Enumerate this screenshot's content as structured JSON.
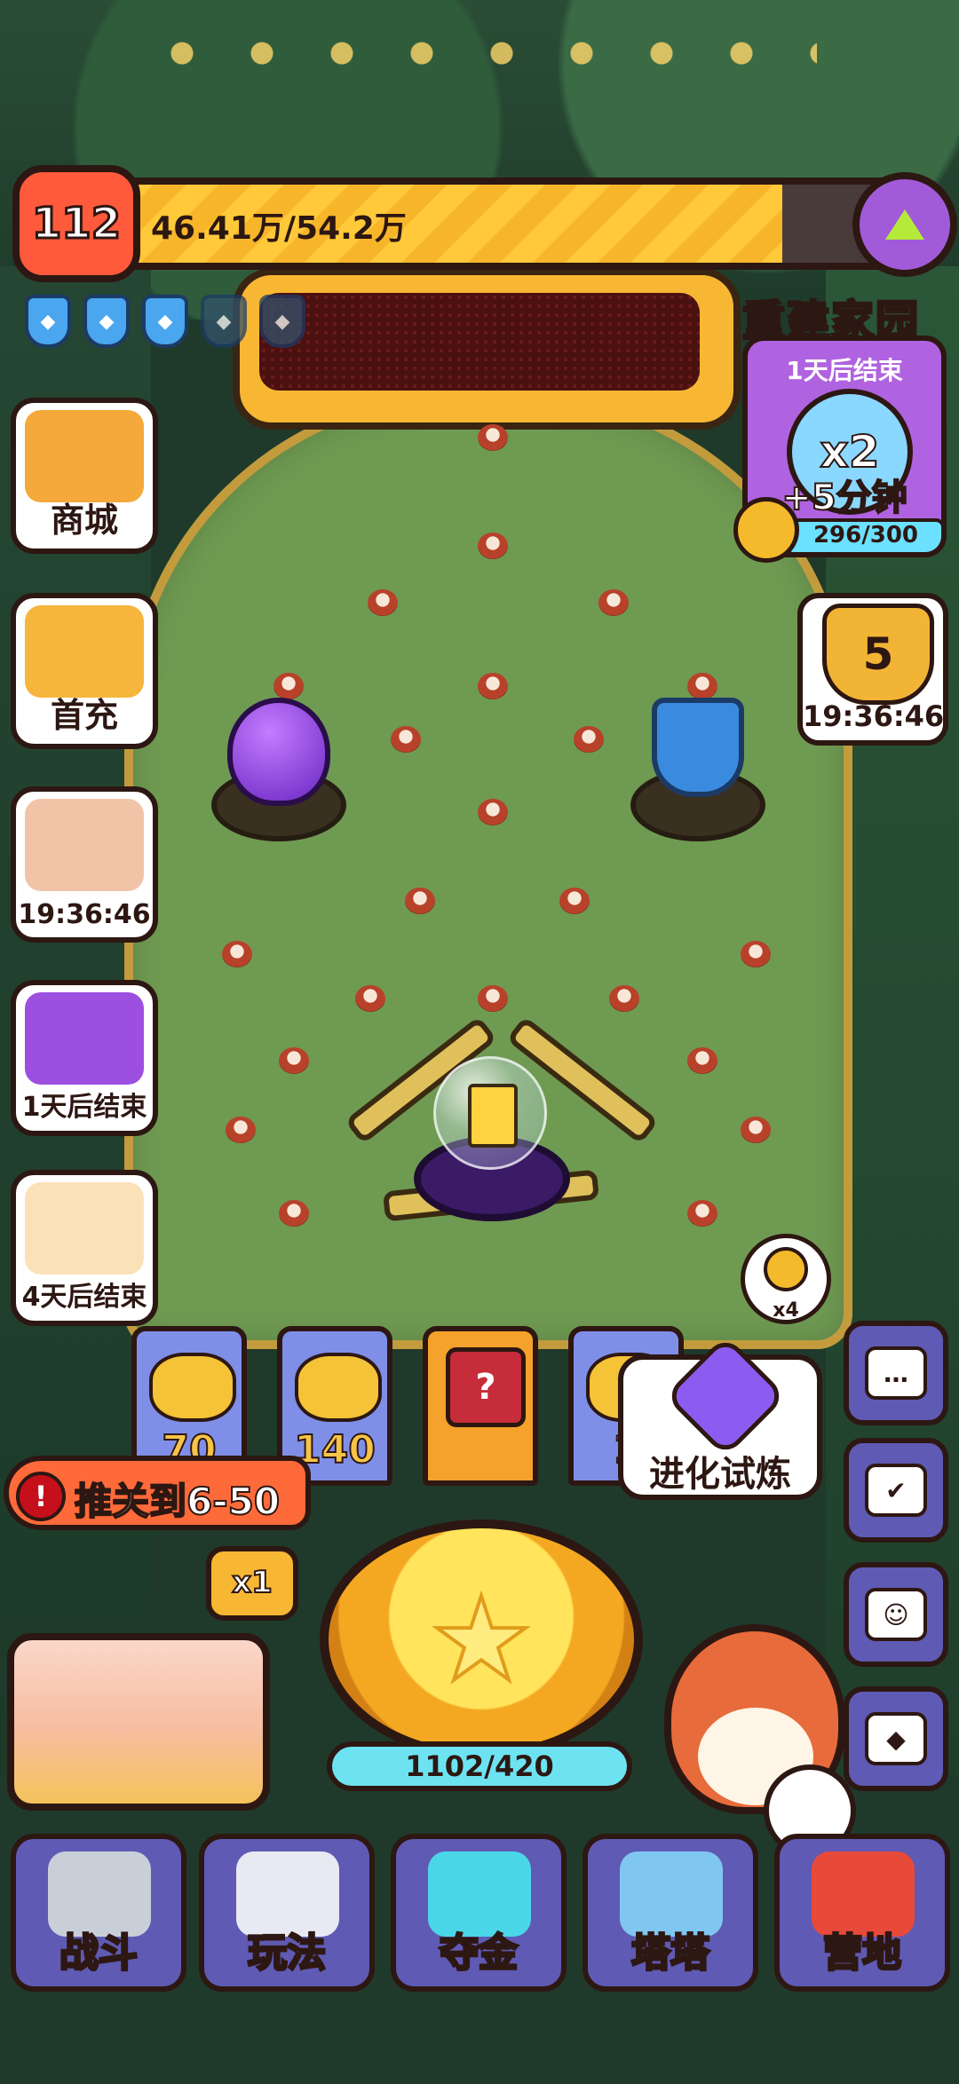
{
  "hud": {
    "level": "112",
    "xp_text": "46.41万/54.2万",
    "xp_progress": 0.856,
    "shields_total": 5,
    "shields_active": 3,
    "upgrade_icon": "green-up-arrow-icon"
  },
  "left_menu": [
    {
      "key": "shop",
      "label": "商城",
      "icon": "basket-icon",
      "color": "#f4a93a"
    },
    {
      "key": "first_charge",
      "label": "首充",
      "icon": "dog-hero-icon",
      "color": "#f6b53c"
    },
    {
      "key": "event_timer",
      "label": "19:36:46",
      "icon": "phoenix-icon",
      "color": "#f1c4a8"
    },
    {
      "key": "wheel_event",
      "label": "1天后结束",
      "icon": "wheel-icon",
      "color": "#9d4fe0"
    },
    {
      "key": "calendar_event",
      "label": "4天后结束",
      "icon": "calendar-icon",
      "color": "#fbe1b8"
    }
  ],
  "event": {
    "title": "重建家园",
    "ends": "1天后结束",
    "multiplier": "x2",
    "bonus": "+5分钟",
    "progress": "296/300"
  },
  "trophy": {
    "count": "5",
    "timer": "19:36:46",
    "icon": "trophy-icon"
  },
  "rewards": [
    {
      "value": "70",
      "type": "coins"
    },
    {
      "value": "140",
      "type": "coins"
    },
    {
      "value": "",
      "type": "mystery",
      "symbol": "?"
    },
    {
      "value": "1",
      "type": "coins"
    }
  ],
  "hint": {
    "count": "x4",
    "icon": "screw-coin-icon"
  },
  "trial": {
    "label": "进化试炼",
    "icon": "cat-emblem-icon"
  },
  "right_buttons": [
    {
      "key": "chat",
      "icon": "chat-bubble-icon",
      "symbol": "…"
    },
    {
      "key": "tasks",
      "icon": "clipboard-check-icon",
      "symbol": "✔"
    },
    {
      "key": "friends",
      "icon": "friends-icon",
      "symbol": "☺"
    },
    {
      "key": "evolve",
      "icon": "cat-badge-icon",
      "symbol": "◆"
    }
  ],
  "stage_push": {
    "label": "推关到6-50",
    "icon": "warning-icon",
    "symbol": "!"
  },
  "multiplier_btn": "x1",
  "spin": {
    "counter": "1102/420",
    "icon": "star-icon",
    "symbol": "★"
  },
  "bottom_nav": [
    {
      "key": "battle",
      "label": "战斗",
      "icon": "crossed-swords-icon",
      "color": "#c9cfd8"
    },
    {
      "key": "play",
      "label": "玩法",
      "icon": "gamepad-icon",
      "color": "#e8eaf3"
    },
    {
      "key": "gold",
      "label": "夺金",
      "icon": "mystery-box-icon",
      "color": "#4bd6e8"
    },
    {
      "key": "tata",
      "label": "塔塔",
      "icon": "cat-mascot-icon",
      "color": "#7fc7f0"
    },
    {
      "key": "camp",
      "label": "营地",
      "icon": "tent-icon",
      "color": "#e84a3a"
    }
  ]
}
